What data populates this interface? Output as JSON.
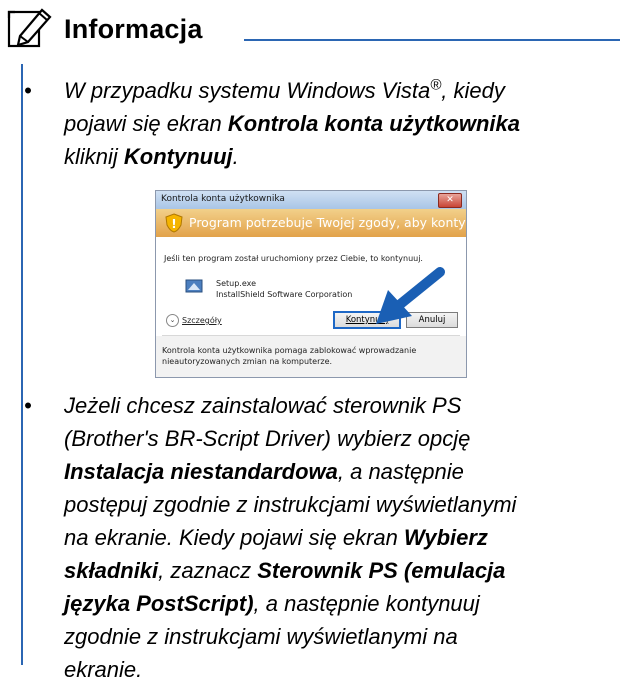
{
  "note": {
    "title": "Informacja",
    "icon": "note-pencil-icon"
  },
  "items": [
    {
      "bullet": "•",
      "lines": [
        [
          {
            "t": "W przypadku systemu Windows Vista"
          },
          {
            "t": "®",
            "sup": true
          },
          {
            "t": ", kiedy"
          }
        ],
        [
          {
            "t": "pojawi się ekran "
          },
          {
            "t": "Kontrola konta użytkownika",
            "b": true
          }
        ],
        [
          {
            "t": "kliknij "
          },
          {
            "t": "Kontynuuj",
            "b": true
          },
          {
            "t": "."
          }
        ]
      ]
    },
    {
      "bullet": "•",
      "lines": [
        [
          {
            "t": "Jeżeli chcesz zainstalować sterownik PS"
          }
        ],
        [
          {
            "t": "(Brother's BR-Script Driver) wybierz opcję"
          }
        ],
        [
          {
            "t": "Instalacja niestandardowa",
            "b": true
          },
          {
            "t": ", a następnie"
          }
        ],
        [
          {
            "t": "postępuj zgodnie z instrukcjami wyświetlanymi"
          }
        ],
        [
          {
            "t": "na ekranie. Kiedy pojawi się ekran "
          },
          {
            "t": "Wybierz",
            "b": true
          }
        ],
        [
          {
            "t": "składniki",
            "b": true
          },
          {
            "t": ", zaznacz "
          },
          {
            "t": "Sterownik PS (emulacja",
            "b": true
          }
        ],
        [
          {
            "t": "języka PostScript)",
            "b": true
          },
          {
            "t": ", a następnie kontynuuj"
          }
        ],
        [
          {
            "t": "zgodnie z instrukcjami wyświetlanymi na"
          }
        ],
        [
          {
            "t": "ekranie."
          }
        ]
      ]
    }
  ],
  "dialog": {
    "title": "Kontrola konta użytkownika",
    "close": "✕",
    "banner": "Program potrzebuje Twojej zgody, aby kontynuować",
    "intro": "Jeśli ten program został uruchomiony przez Ciebie, to kontynuuj.",
    "program_name": "Setup.exe",
    "publisher": "InstallShield Software Corporation",
    "details": "Szczegóły",
    "continue": "Kontynuuj",
    "cancel": "Anuluj",
    "footer_line1": "Kontrola konta użytkownika pomaga zablokować wprowadzanie",
    "footer_line2": "nieautoryzowanych zmian na komputerze."
  },
  "colors": {
    "accent": "#2b66b3",
    "banner": "#e2a24a",
    "arrow": "#1a5fb4"
  }
}
